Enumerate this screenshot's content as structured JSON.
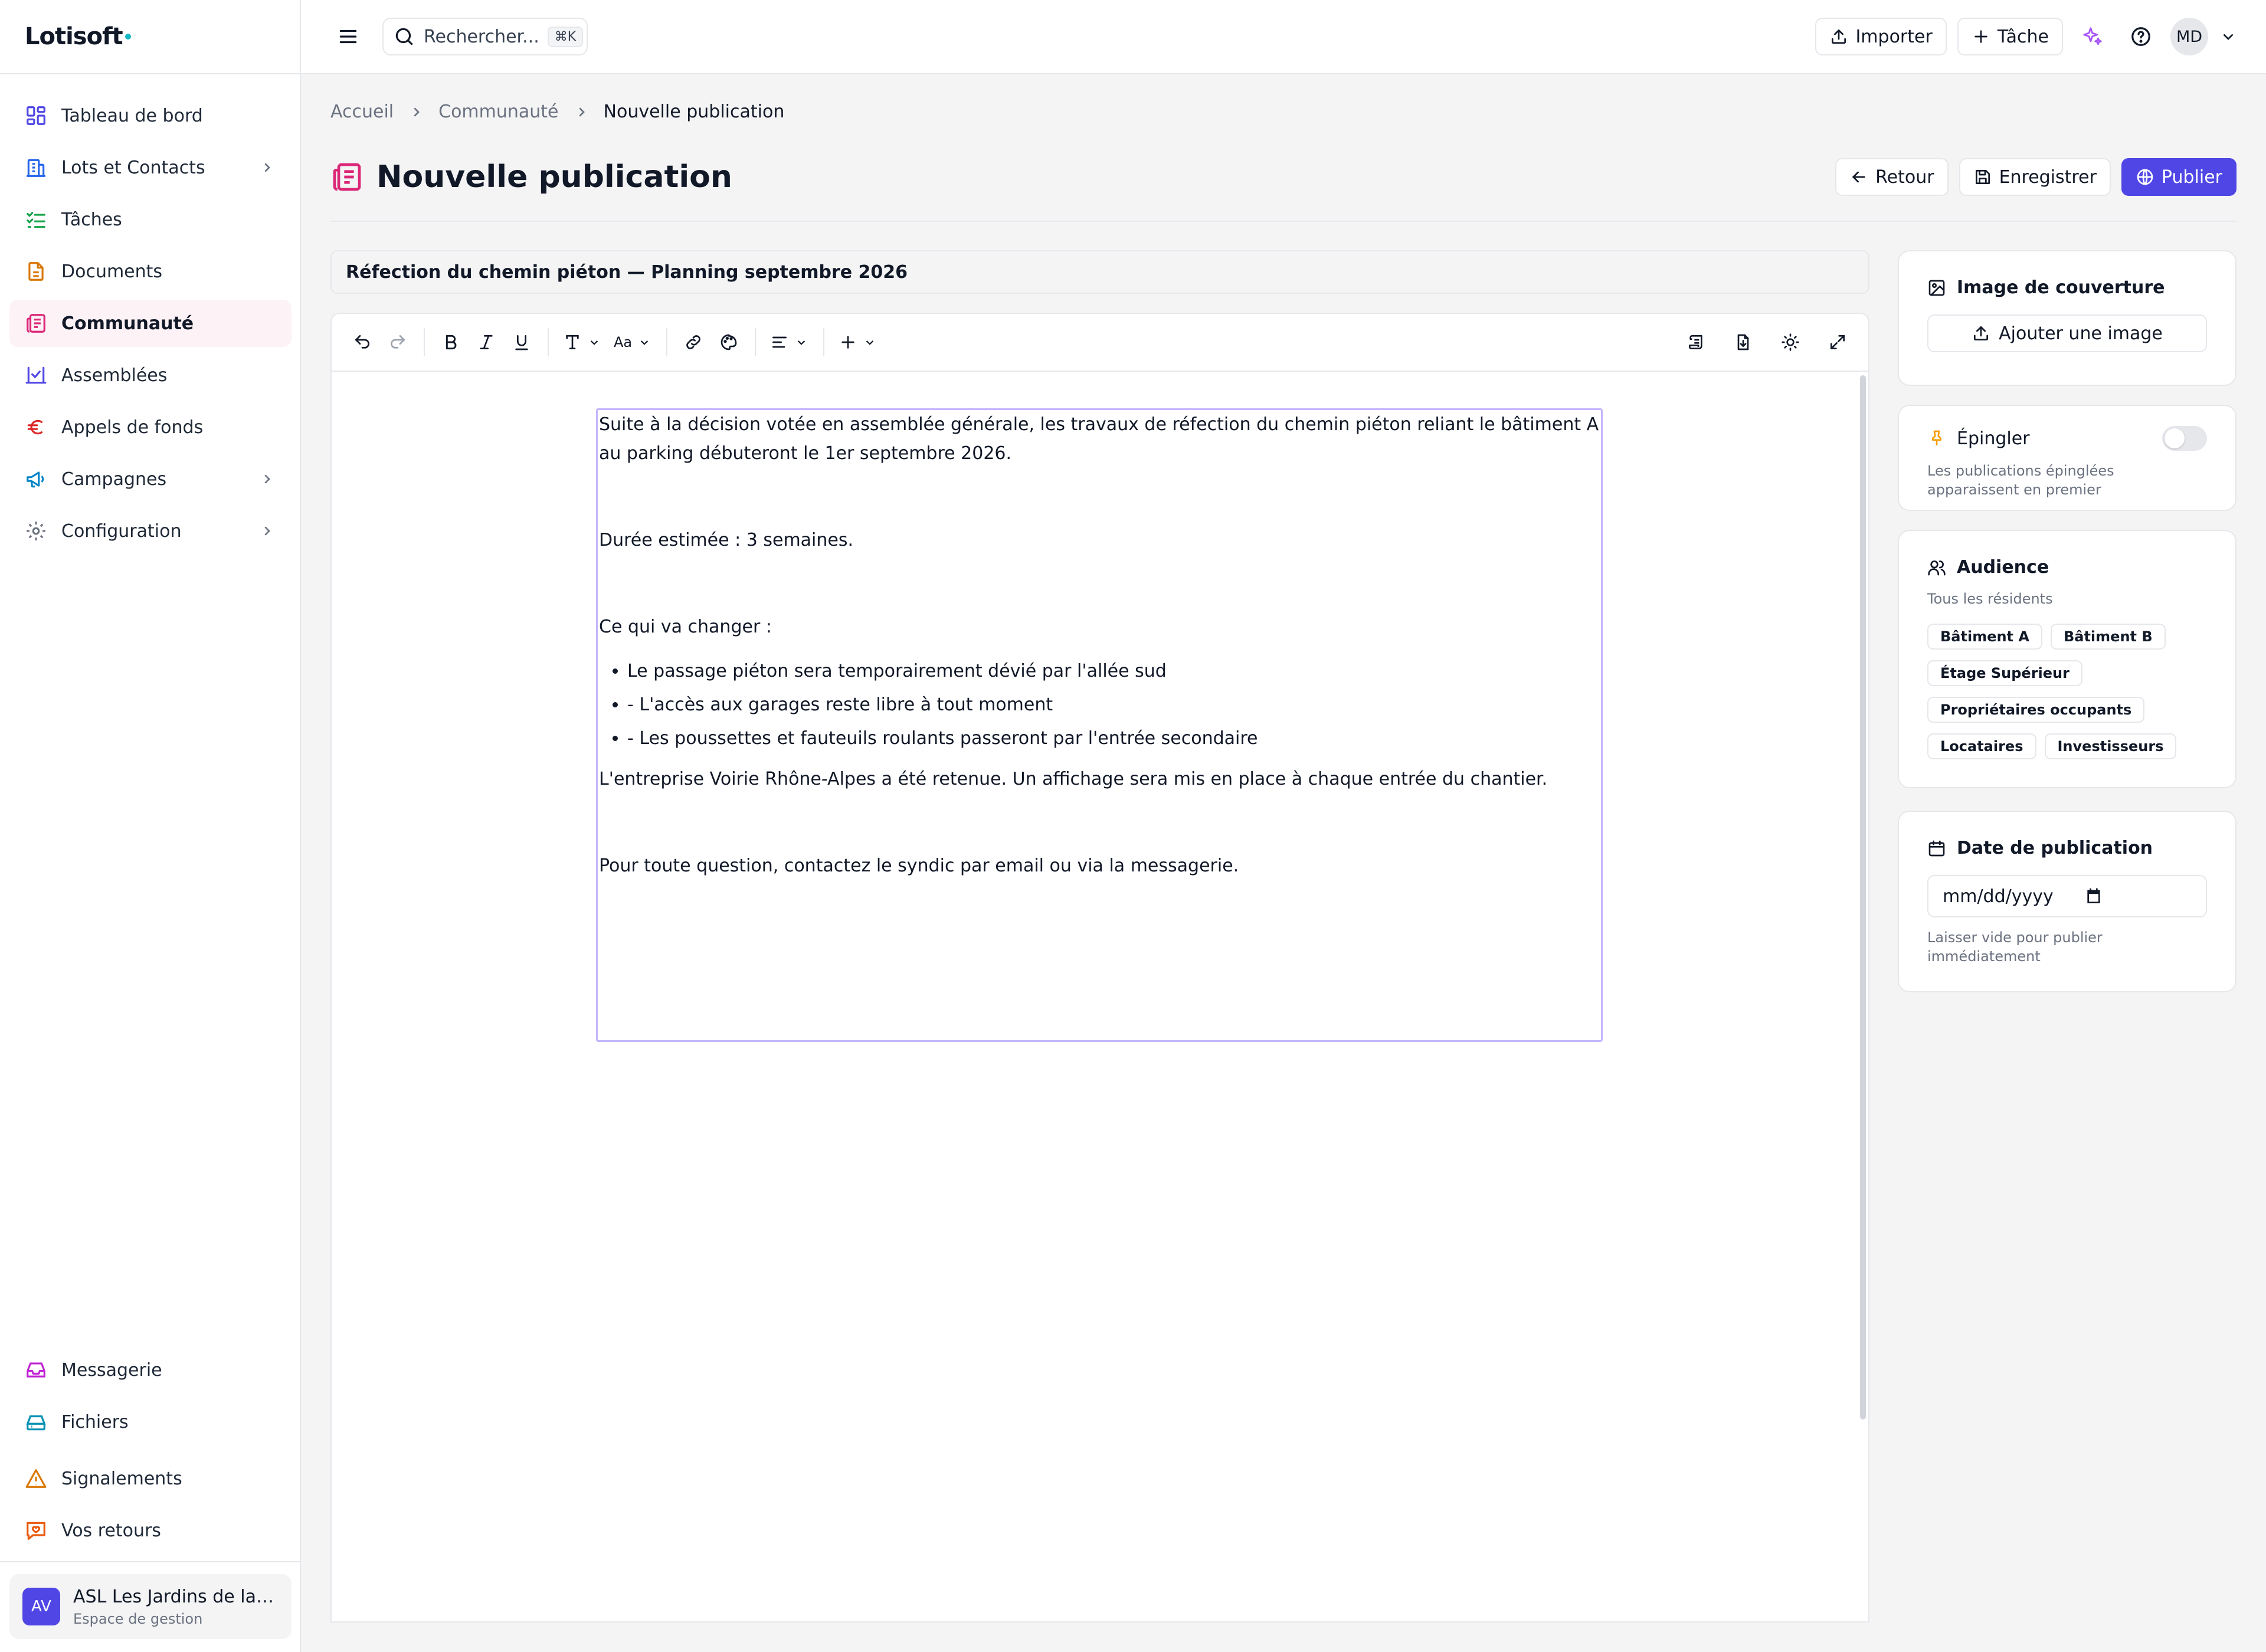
{
  "topbar": {
    "logo": "Lotisoft",
    "search_placeholder": "Rechercher...",
    "search_shortcut": "⌘K",
    "import_label": "Importer",
    "task_label": "Tâche",
    "user_initials": "MD"
  },
  "sidebar": {
    "items": [
      {
        "label": "Tableau de bord",
        "icon": "dashboard-icon",
        "color": "#4f46e5"
      },
      {
        "label": "Lots et Contacts",
        "icon": "building-icon",
        "color": "#2563eb",
        "has_submenu": true
      },
      {
        "label": "Tâches",
        "icon": "checklist-icon",
        "color": "#16a34a"
      },
      {
        "label": "Documents",
        "icon": "document-icon",
        "color": "#d97706"
      },
      {
        "label": "Communauté",
        "icon": "newspaper-icon",
        "color": "#db2777",
        "active": true
      },
      {
        "label": "Assemblées",
        "icon": "vote-icon",
        "color": "#4f46e5"
      },
      {
        "label": "Appels de fonds",
        "icon": "euro-icon",
        "color": "#dc2626"
      },
      {
        "label": "Campagnes",
        "icon": "megaphone-icon",
        "color": "#0284c7",
        "has_submenu": true
      },
      {
        "label": "Configuration",
        "icon": "gear-icon",
        "color": "#6b7280",
        "has_submenu": true
      }
    ],
    "bottom_items": [
      {
        "label": "Messagerie",
        "icon": "inbox-icon",
        "color": "#c026d3"
      },
      {
        "label": "Fichiers",
        "icon": "drive-icon",
        "color": "#0891b2"
      },
      {
        "label": "Signalements",
        "icon": "warning-icon",
        "color": "#d97706"
      },
      {
        "label": "Vos retours",
        "icon": "feedback-icon",
        "color": "#ea580c"
      }
    ],
    "org": {
      "initials": "AV",
      "name": "ASL Les Jardins de la ...",
      "subtitle": "Espace de gestion"
    }
  },
  "breadcrumb": [
    "Accueil",
    "Communauté",
    "Nouvelle publication"
  ],
  "page": {
    "title": "Nouvelle publication",
    "back_label": "Retour",
    "save_label": "Enregistrer",
    "publish_label": "Publier"
  },
  "editor": {
    "title_value": "Réfection du chemin piéton — Planning septembre 2026",
    "toolbar_font_size_label": "Aa",
    "content": {
      "p1": "Suite à la décision votée en assemblée générale, les travaux de réfection du chemin piéton reliant le bâtiment A au parking débuteront le 1er septembre 2026.",
      "p2": "Durée estimée : 3 semaines.",
      "p3": "Ce qui va changer :",
      "list": [
        "Le passage piéton sera temporairement dévié par l'allée sud",
        "- L'accès aux garages reste libre à tout moment",
        "- Les poussettes et fauteuils roulants passeront par l'entrée secondaire"
      ],
      "p4": "L'entreprise Voirie Rhône-Alpes a été retenue. Un affichage sera mis en place à chaque entrée du chantier.",
      "p5": "Pour toute question, contactez le syndic par email ou via la messagerie."
    }
  },
  "panel": {
    "cover": {
      "title": "Image de couverture",
      "button": "Ajouter une image"
    },
    "pin": {
      "title": "Épingler",
      "help": "Les publications épinglées apparaissent en premier",
      "enabled": false
    },
    "audience": {
      "title": "Audience",
      "subtitle": "Tous les résidents",
      "chips": [
        "Bâtiment A",
        "Bâtiment B",
        "Étage Supérieur",
        "Propriétaires occupants",
        "Locataires",
        "Investisseurs"
      ]
    },
    "date": {
      "title": "Date de publication",
      "placeholder": "mm/dd/yyyy",
      "help": "Laisser vide pour publier immédiatement"
    }
  },
  "colors": {
    "accent": "#4f46e5",
    "active_bg": "#fdf2f5",
    "editor_outline": "#c4b5fd"
  }
}
